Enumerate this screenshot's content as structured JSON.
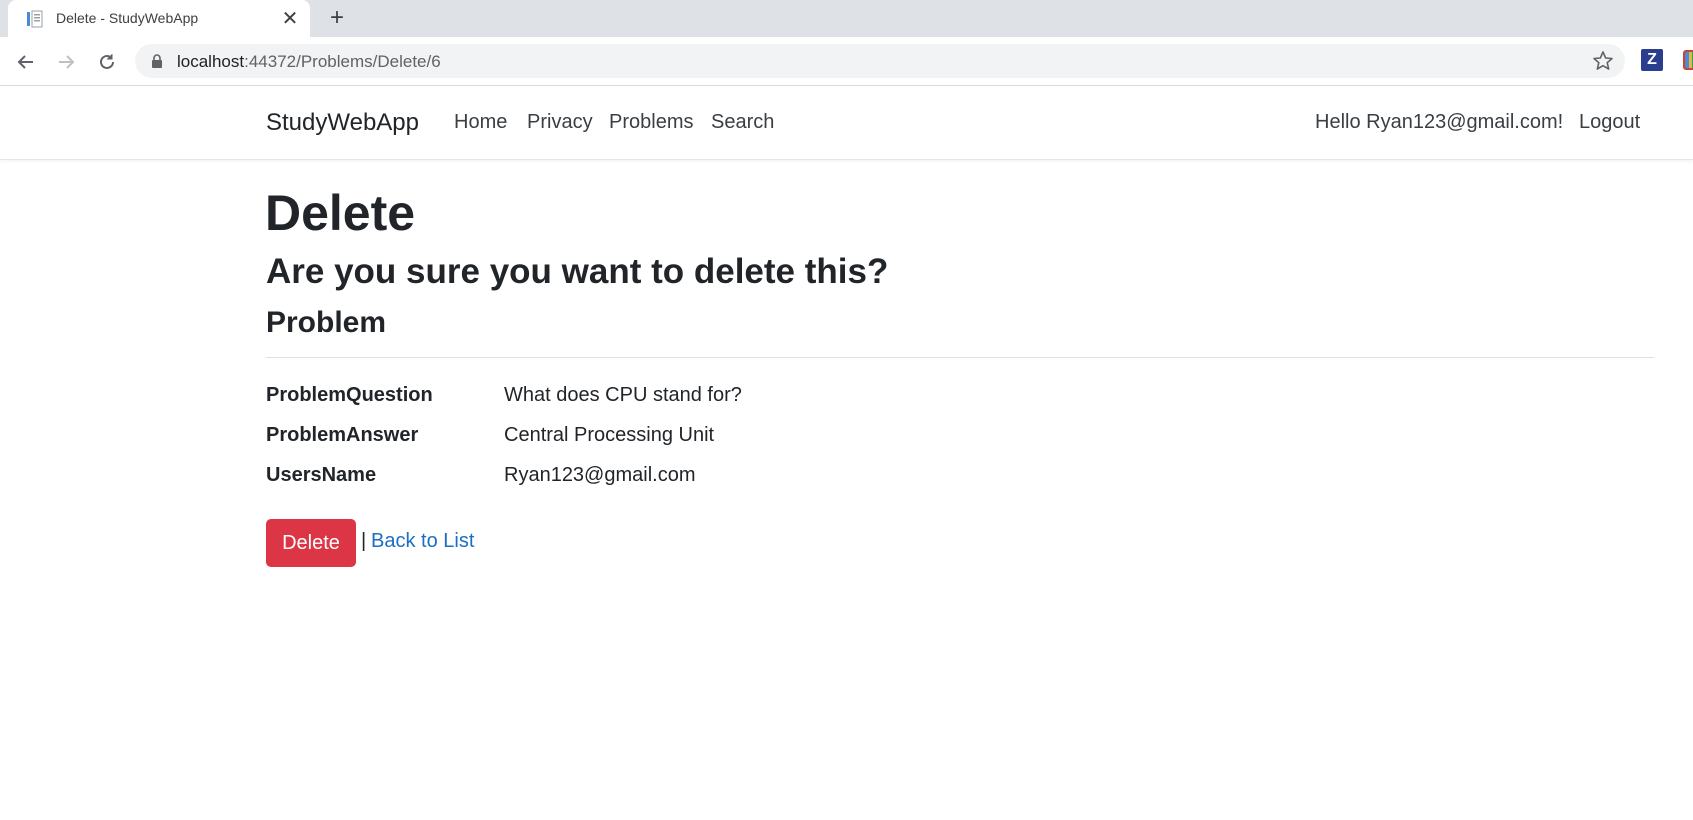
{
  "browser": {
    "tab_title": "Delete - StudyWebApp",
    "new_tab_glyph": "+",
    "close_glyph": "✕",
    "url_host": "localhost",
    "url_rest": ":44372/Problems/Delete/6",
    "extension_label": "Z"
  },
  "nav": {
    "brand": "StudyWebApp",
    "links": [
      "Home",
      "Privacy",
      "Problems",
      "Search"
    ],
    "greeting": "Hello Ryan123@gmail.com!",
    "logout": "Logout"
  },
  "page": {
    "title": "Delete",
    "confirm_question": "Are you sure you want to delete this?",
    "entity_name": "Problem",
    "fields": [
      {
        "label": "ProblemQuestion",
        "value": "What does CPU stand for?"
      },
      {
        "label": "ProblemAnswer",
        "value": "Central Processing Unit"
      },
      {
        "label": "UsersName",
        "value": "Ryan123@gmail.com"
      }
    ],
    "delete_button": "Delete",
    "separator": "|",
    "back_link": "Back to List"
  },
  "colors": {
    "danger": "#dc3545",
    "link": "#1b6ec2",
    "tabstrip": "#dee1e6"
  }
}
